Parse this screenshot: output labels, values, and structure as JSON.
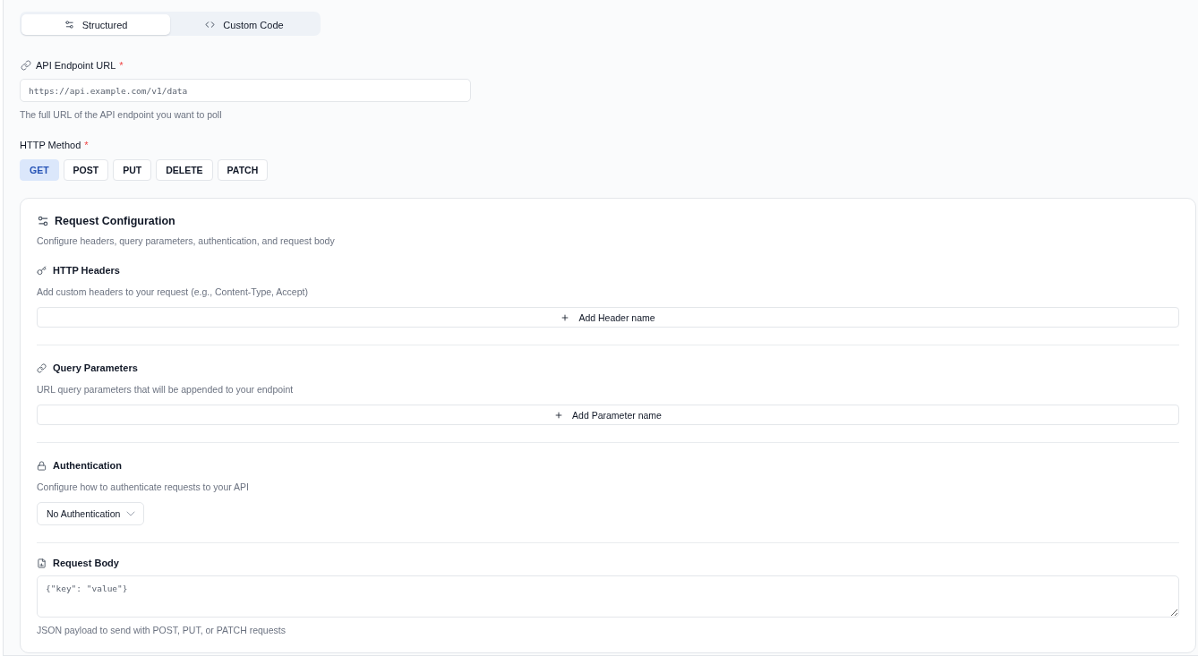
{
  "mode_tabs": [
    {
      "label": "Structured",
      "selected": true
    },
    {
      "label": "Custom Code",
      "selected": false
    }
  ],
  "endpoint": {
    "label": "API Endpoint URL",
    "required_mark": "*",
    "placeholder": "https://api.example.com/v1/data",
    "help": "The full URL of the API endpoint you want to poll"
  },
  "http_method": {
    "label": "HTTP Method",
    "required_mark": "*",
    "options": [
      {
        "label": "GET",
        "selected": true
      },
      {
        "label": "POST",
        "selected": false
      },
      {
        "label": "PUT",
        "selected": false
      },
      {
        "label": "DELETE",
        "selected": false
      },
      {
        "label": "PATCH",
        "selected": false
      }
    ]
  },
  "request_config": {
    "title": "Request Configuration",
    "subtitle": "Configure headers, query parameters, authentication, and request body",
    "sections": [
      {
        "kind": "list",
        "title": "HTTP Headers",
        "description": "Add custom headers to your request (e.g., Content-Type, Accept)",
        "add_button": "Add Header name"
      },
      {
        "kind": "list",
        "title": "Query Parameters",
        "description": "URL query parameters that will be appended to your endpoint",
        "add_button": "Add Parameter name"
      },
      {
        "kind": "select",
        "title": "Authentication",
        "description": "Configure how to authenticate requests to your API",
        "value": "No Authentication"
      },
      {
        "kind": "textarea",
        "title": "Request Body",
        "placeholder": "{\"key\": \"value\"}",
        "help": "JSON payload to send with POST, PUT, or PATCH requests"
      }
    ]
  }
}
